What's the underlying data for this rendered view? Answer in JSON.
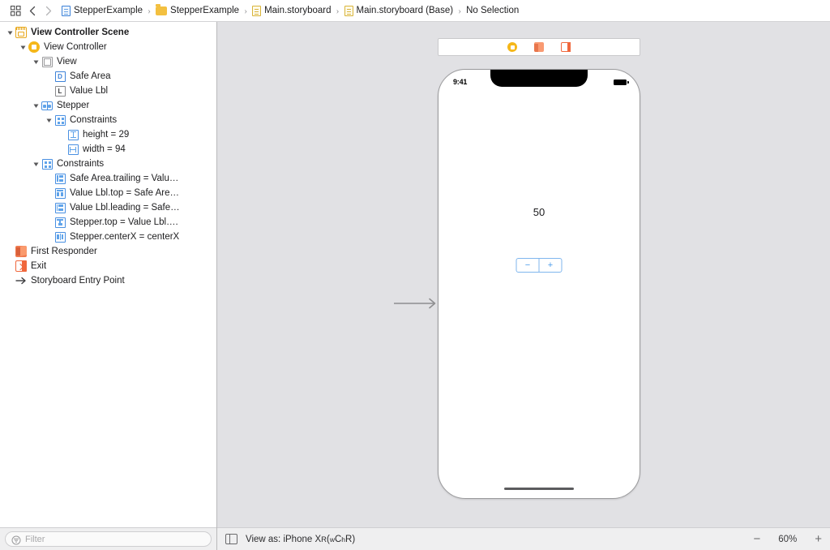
{
  "jumpbar": {
    "grid_icon": "grid-icon",
    "back_icon": "chevron-left-icon",
    "forward_icon": "chevron-right-icon",
    "crumbs": [
      {
        "label": "StepperExample",
        "icon": "project-document-icon"
      },
      {
        "label": "StepperExample",
        "icon": "folder-icon"
      },
      {
        "label": "Main.storyboard",
        "icon": "storyboard-document-icon"
      },
      {
        "label": "Main.storyboard (Base)",
        "icon": "storyboard-document-icon"
      },
      {
        "label": "No Selection",
        "icon": "none"
      }
    ],
    "separator": "›"
  },
  "outline": {
    "items": [
      {
        "label": "View Controller Scene",
        "indent": 0,
        "twisty": "down",
        "icon": "scene-icon",
        "bold": true
      },
      {
        "label": "View Controller",
        "indent": 1,
        "twisty": "down",
        "icon": "view-controller-icon",
        "bold": false
      },
      {
        "label": "View",
        "indent": 2,
        "twisty": "down",
        "icon": "view-icon",
        "bold": false
      },
      {
        "label": "Safe Area",
        "indent": 3,
        "twisty": "none",
        "icon": "safe-area-icon",
        "bold": false
      },
      {
        "label": "Value Lbl",
        "indent": 3,
        "twisty": "none",
        "icon": "label-icon",
        "bold": false
      },
      {
        "label": "Stepper",
        "indent": 2,
        "twisty": "down",
        "icon": "stepper-icon",
        "bold": false
      },
      {
        "label": "Constraints",
        "indent": 3,
        "twisty": "down",
        "icon": "constraints-group-icon",
        "bold": false
      },
      {
        "label": "height = 29",
        "indent": 4,
        "twisty": "none",
        "icon": "constraint-height-icon",
        "bold": false
      },
      {
        "label": "width = 94",
        "indent": 4,
        "twisty": "none",
        "icon": "constraint-width-icon",
        "bold": false
      },
      {
        "label": "Constraints",
        "indent": 2,
        "twisty": "down",
        "icon": "constraints-group-icon",
        "bold": false
      },
      {
        "label": "Safe Area.trailing = Valu…",
        "indent": 3,
        "twisty": "none",
        "icon": "constraint-trailing-icon",
        "bold": false
      },
      {
        "label": "Value Lbl.top = Safe Are…",
        "indent": 3,
        "twisty": "none",
        "icon": "constraint-top-icon",
        "bold": false
      },
      {
        "label": "Value Lbl.leading = Safe…",
        "indent": 3,
        "twisty": "none",
        "icon": "constraint-leading-icon",
        "bold": false
      },
      {
        "label": "Stepper.top = Value Lbl….",
        "indent": 3,
        "twisty": "none",
        "icon": "constraint-top-align-icon",
        "bold": false
      },
      {
        "label": "Stepper.centerX = centerX",
        "indent": 3,
        "twisty": "none",
        "icon": "constraint-centerx-icon",
        "bold": false
      },
      {
        "label": "First Responder",
        "indent": 0,
        "twisty": "none",
        "icon": "first-responder-icon",
        "bold": false
      },
      {
        "label": "Exit",
        "indent": 0,
        "twisty": "none",
        "icon": "exit-icon",
        "bold": false
      },
      {
        "label": "Storyboard Entry Point",
        "indent": 0,
        "twisty": "none",
        "icon": "entry-point-arrow-icon",
        "bold": false
      }
    ],
    "filter_placeholder": "Filter",
    "filter_value": ""
  },
  "canvas": {
    "dock_icons": [
      {
        "name": "view-controller-dock-icon"
      },
      {
        "name": "first-responder-dock-icon"
      },
      {
        "name": "exit-dock-icon"
      }
    ],
    "device": {
      "status_time": "9:41",
      "value_label": "50",
      "stepper_minus": "−",
      "stepper_plus": "+"
    }
  },
  "bottombar": {
    "panel_toggle_icon": "show-document-outline-icon",
    "view_as_prefix": "View as: iPhone X",
    "view_as_suffix_r": "R",
    "size_class_open": " (",
    "size_class_w": "w",
    "size_class_wc": "C ",
    "size_class_h": "h",
    "size_class_hr": "R)",
    "zoom_out": "−",
    "zoom_value": "60%",
    "zoom_in": "+"
  },
  "colors": {
    "canvas_bg": "#e1e1e4",
    "accent_blue": "#4a9bea",
    "constraint_blue": "#4a90e2",
    "scene_yellow": "#e8a81c",
    "vc_yellow": "#f5b719",
    "exit_orange": "#f0673c"
  }
}
